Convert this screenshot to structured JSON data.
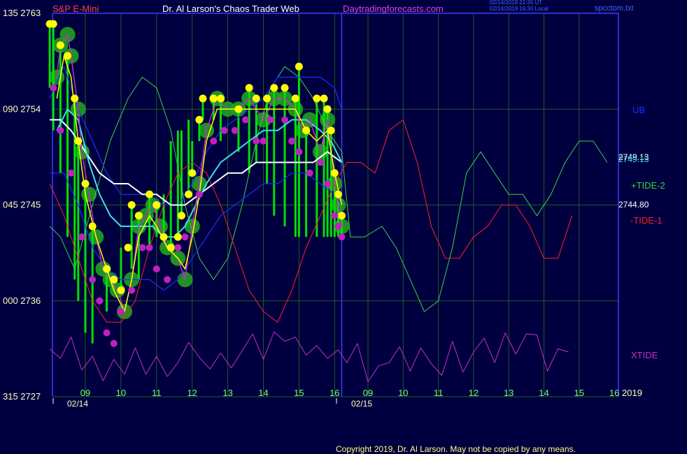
{
  "header": {
    "symbol": "S&P E-Mini",
    "title": "Dr. Al Larson's Chaos Trader Web",
    "site": "Daytradingforecasts.com",
    "stamp_line1": "02/14/2019 21:30 UT",
    "stamp_line2": "02/14/2019 16:30 Local",
    "file": "spcctom.txt"
  },
  "footer": {
    "copyright": "Copyright 2019, Dr. Al Larson. May not be copied by any means."
  },
  "colors": {
    "background": "#000040",
    "grid": "#1f5a1f",
    "axis": "#3a3aff",
    "price_labels": "#ffffc0",
    "time_labels": "#6fff6f",
    "ub": "#1a2fff",
    "lb": "#1a2fff",
    "tide2": "#39d339",
    "tide1": "#ff2020",
    "xtide": "#c030c0",
    "fast_ma": "#ffff00",
    "mid_ma": "#40e0e0",
    "slow_ma": "#ffffff",
    "bars": "#00e000",
    "bubbles": "#22a022",
    "highs": "#ffff00",
    "lows": "#c020c0",
    "title_red": "#ff4040",
    "title_white": "#ffffff",
    "site_magenta": "#e040e0"
  },
  "chart_data": {
    "type": "line",
    "ylim": [
      2727,
      2763
    ],
    "price_ticks": [
      2763,
      2754,
      2745,
      2736,
      2727
    ],
    "left_ticks": [
      "135",
      "090",
      "045",
      "000",
      "315"
    ],
    "hour_labels_day1": [
      "09",
      "10",
      "11",
      "12",
      "13",
      "14",
      "15",
      "16"
    ],
    "hour_labels_day2": [
      "09",
      "10",
      "11",
      "12",
      "13",
      "14",
      "15",
      "16"
    ],
    "date_labels": [
      "02/14",
      "02/15"
    ],
    "year_label": "2019",
    "xlim": [
      7.9,
      40
    ],
    "last_values": [
      "2749.13",
      "2749.13",
      "2744.80"
    ],
    "series_labels": {
      "ub": "UB",
      "tide2": "+TIDE-2",
      "tide1": "-TIDE-1",
      "xtide": "XTIDE"
    },
    "close": [
      [
        8.2,
        2757
      ],
      [
        8.3,
        2760
      ],
      [
        8.5,
        2761
      ],
      [
        8.6,
        2759
      ],
      [
        8.8,
        2754
      ],
      [
        8.9,
        2750
      ],
      [
        9.1,
        2746
      ],
      [
        9.3,
        2742
      ],
      [
        9.5,
        2739
      ],
      [
        9.7,
        2738
      ],
      [
        9.9,
        2737
      ],
      [
        10.1,
        2735
      ],
      [
        10.3,
        2738
      ],
      [
        10.5,
        2743
      ],
      [
        10.7,
        2744
      ],
      [
        10.9,
        2745
      ],
      [
        11.1,
        2743
      ],
      [
        11.3,
        2741
      ],
      [
        11.6,
        2740
      ],
      [
        11.8,
        2738
      ],
      [
        12.0,
        2743
      ],
      [
        12.2,
        2747
      ],
      [
        12.4,
        2752
      ],
      [
        12.7,
        2755
      ],
      [
        13.0,
        2754
      ],
      [
        13.3,
        2754
      ],
      [
        13.6,
        2755
      ],
      [
        14.0,
        2753
      ],
      [
        14.3,
        2755
      ],
      [
        14.6,
        2755
      ],
      [
        14.9,
        2754
      ],
      [
        15.1,
        2752
      ],
      [
        15.3,
        2753
      ],
      [
        15.6,
        2750
      ],
      [
        15.8,
        2753
      ],
      [
        16.0,
        2747
      ],
      [
        16.1,
        2745
      ],
      [
        16.2,
        2743
      ]
    ],
    "highs": [
      [
        8.0,
        2762
      ],
      [
        8.1,
        2762
      ],
      [
        8.3,
        2760
      ],
      [
        8.5,
        2759
      ],
      [
        8.7,
        2755
      ],
      [
        8.8,
        2751
      ],
      [
        9.0,
        2747
      ],
      [
        9.2,
        2743
      ],
      [
        9.6,
        2739
      ],
      [
        9.8,
        2738
      ],
      [
        10.0,
        2737
      ],
      [
        10.2,
        2741
      ],
      [
        10.3,
        2745
      ],
      [
        10.5,
        2744
      ],
      [
        10.8,
        2746
      ],
      [
        11.0,
        2745
      ],
      [
        11.2,
        2742
      ],
      [
        11.4,
        2741
      ],
      [
        11.6,
        2742
      ],
      [
        11.7,
        2744
      ],
      [
        11.9,
        2746
      ],
      [
        12.0,
        2748
      ],
      [
        12.2,
        2753
      ],
      [
        12.3,
        2755
      ],
      [
        12.6,
        2755
      ],
      [
        12.8,
        2755
      ],
      [
        13.3,
        2754
      ],
      [
        13.6,
        2756
      ],
      [
        13.8,
        2755
      ],
      [
        14.1,
        2755
      ],
      [
        14.3,
        2756
      ],
      [
        14.6,
        2756
      ],
      [
        14.9,
        2755
      ],
      [
        15.0,
        2758
      ],
      [
        15.2,
        2752
      ],
      [
        15.5,
        2755
      ],
      [
        15.7,
        2755
      ],
      [
        15.8,
        2754
      ],
      [
        15.9,
        2752
      ],
      [
        16.0,
        2748
      ],
      [
        16.1,
        2746
      ],
      [
        16.2,
        2744
      ]
    ],
    "lows": [
      [
        8.1,
        2756
      ],
      [
        8.3,
        2752
      ],
      [
        8.6,
        2748
      ],
      [
        8.9,
        2742
      ],
      [
        9.2,
        2738
      ],
      [
        9.4,
        2736
      ],
      [
        9.6,
        2733
      ],
      [
        9.8,
        2732
      ],
      [
        10.0,
        2735
      ],
      [
        10.3,
        2737
      ],
      [
        10.6,
        2741
      ],
      [
        10.8,
        2741
      ],
      [
        11.0,
        2739
      ],
      [
        11.3,
        2738
      ],
      [
        11.6,
        2741
      ],
      [
        11.8,
        2742
      ],
      [
        12.2,
        2746
      ],
      [
        12.6,
        2751
      ],
      [
        12.9,
        2752
      ],
      [
        13.2,
        2752
      ],
      [
        13.5,
        2753
      ],
      [
        13.8,
        2751
      ],
      [
        14.0,
        2751
      ],
      [
        14.2,
        2753
      ],
      [
        14.6,
        2753
      ],
      [
        14.8,
        2751
      ],
      [
        15.0,
        2750
      ],
      [
        15.3,
        2748
      ],
      [
        15.6,
        2749
      ],
      [
        15.8,
        2747
      ],
      [
        16.0,
        2744
      ],
      [
        16.1,
        2743
      ],
      [
        16.2,
        2742
      ]
    ],
    "fast_ma": [
      [
        8.2,
        2755
      ],
      [
        8.4,
        2759
      ],
      [
        8.6,
        2757
      ],
      [
        8.8,
        2751
      ],
      [
        9.0,
        2746
      ],
      [
        9.3,
        2742
      ],
      [
        9.6,
        2739
      ],
      [
        9.8,
        2737
      ],
      [
        10.1,
        2735
      ],
      [
        10.3,
        2738
      ],
      [
        10.5,
        2742
      ],
      [
        10.8,
        2744
      ],
      [
        11.0,
        2743
      ],
      [
        11.3,
        2741
      ],
      [
        11.6,
        2740
      ],
      [
        11.8,
        2739
      ],
      [
        12.0,
        2742
      ],
      [
        12.2,
        2746
      ],
      [
        12.4,
        2751
      ],
      [
        12.7,
        2754
      ],
      [
        13.0,
        2754
      ],
      [
        13.4,
        2754
      ],
      [
        13.8,
        2754
      ],
      [
        14.2,
        2754
      ],
      [
        14.6,
        2754
      ],
      [
        14.9,
        2754
      ],
      [
        15.2,
        2752
      ],
      [
        15.5,
        2751
      ],
      [
        15.8,
        2752
      ],
      [
        16.0,
        2748
      ],
      [
        16.2,
        2745
      ]
    ],
    "mid_ma": [
      [
        8.2,
        2752
      ],
      [
        8.5,
        2754
      ],
      [
        8.8,
        2753
      ],
      [
        9.1,
        2749
      ],
      [
        9.4,
        2746
      ],
      [
        9.7,
        2744
      ],
      [
        10.0,
        2743
      ],
      [
        10.3,
        2743
      ],
      [
        10.6,
        2743
      ],
      [
        10.9,
        2743
      ],
      [
        11.2,
        2742
      ],
      [
        11.5,
        2742
      ],
      [
        11.8,
        2743
      ],
      [
        12.1,
        2745
      ],
      [
        12.4,
        2747
      ],
      [
        12.8,
        2749
      ],
      [
        13.2,
        2750
      ],
      [
        13.6,
        2751
      ],
      [
        14.0,
        2752
      ],
      [
        14.4,
        2752
      ],
      [
        14.8,
        2753
      ],
      [
        15.2,
        2753
      ],
      [
        15.6,
        2752
      ],
      [
        15.9,
        2751
      ],
      [
        16.2,
        2749
      ]
    ],
    "slow_ma": [
      [
        8.0,
        2753
      ],
      [
        8.3,
        2753
      ],
      [
        8.6,
        2752
      ],
      [
        9.0,
        2750
      ],
      [
        9.4,
        2748
      ],
      [
        9.8,
        2747
      ],
      [
        10.2,
        2747
      ],
      [
        10.6,
        2746
      ],
      [
        11.0,
        2746
      ],
      [
        11.4,
        2745
      ],
      [
        11.8,
        2745
      ],
      [
        12.2,
        2746
      ],
      [
        12.6,
        2747
      ],
      [
        13.0,
        2748
      ],
      [
        13.4,
        2748
      ],
      [
        13.8,
        2749
      ],
      [
        14.2,
        2749
      ],
      [
        14.6,
        2749
      ],
      [
        15.0,
        2749
      ],
      [
        15.4,
        2749
      ],
      [
        15.8,
        2750
      ],
      [
        16.2,
        2749
      ]
    ],
    "ub": [
      [
        8.0,
        2755
      ],
      [
        8.4,
        2758
      ],
      [
        8.8,
        2754
      ],
      [
        9.2,
        2751
      ],
      [
        9.6,
        2748
      ],
      [
        10.0,
        2746
      ],
      [
        10.4,
        2746
      ],
      [
        10.8,
        2746
      ],
      [
        11.2,
        2745
      ],
      [
        11.6,
        2745
      ],
      [
        12.0,
        2747
      ],
      [
        12.4,
        2750
      ],
      [
        12.8,
        2752
      ],
      [
        13.2,
        2753
      ],
      [
        13.6,
        2754
      ],
      [
        14.0,
        2755
      ],
      [
        14.4,
        2757
      ],
      [
        14.8,
        2757
      ],
      [
        15.2,
        2757
      ],
      [
        15.6,
        2757
      ],
      [
        16.0,
        2756
      ],
      [
        16.2,
        2754
      ]
    ],
    "lb": [
      [
        8.0,
        2748
      ],
      [
        8.4,
        2748
      ],
      [
        8.8,
        2745
      ],
      [
        9.2,
        2741
      ],
      [
        9.6,
        2739
      ],
      [
        10.0,
        2738
      ],
      [
        10.4,
        2738
      ],
      [
        10.8,
        2738
      ],
      [
        11.2,
        2737
      ],
      [
        11.6,
        2738
      ],
      [
        12.0,
        2740
      ],
      [
        12.4,
        2742
      ],
      [
        12.8,
        2744
      ],
      [
        13.2,
        2745
      ],
      [
        13.6,
        2746
      ],
      [
        14.0,
        2747
      ],
      [
        14.4,
        2747
      ],
      [
        14.8,
        2748
      ],
      [
        15.2,
        2748
      ],
      [
        15.6,
        2747
      ],
      [
        16.0,
        2746
      ],
      [
        16.2,
        2745
      ]
    ],
    "tide2": [
      [
        8.0,
        2743
      ],
      [
        8.3,
        2742
      ],
      [
        8.7,
        2739
      ],
      [
        9.2,
        2745
      ],
      [
        9.7,
        2751
      ],
      [
        10.2,
        2755
      ],
      [
        10.6,
        2757
      ],
      [
        11.0,
        2756
      ],
      [
        11.4,
        2752
      ],
      [
        11.8,
        2745
      ],
      [
        12.2,
        2740
      ],
      [
        12.6,
        2738
      ],
      [
        13.0,
        2740
      ],
      [
        13.4,
        2745
      ],
      [
        13.8,
        2751
      ],
      [
        14.2,
        2756
      ],
      [
        14.6,
        2758
      ],
      [
        15.0,
        2757
      ],
      [
        15.4,
        2755
      ],
      [
        15.8,
        2752
      ],
      [
        16.2,
        2750
      ],
      [
        16.5,
        2742
      ],
      [
        16.9,
        2742
      ],
      [
        17.4,
        2743
      ],
      [
        17.8,
        2741
      ],
      [
        18.2,
        2738
      ],
      [
        18.6,
        2735
      ],
      [
        19.0,
        2736
      ],
      [
        19.4,
        2741
      ],
      [
        19.8,
        2748
      ],
      [
        20.2,
        2750
      ],
      [
        20.6,
        2748
      ],
      [
        21.0,
        2746
      ],
      [
        21.4,
        2746
      ],
      [
        21.8,
        2744
      ],
      [
        22.2,
        2746
      ],
      [
        22.6,
        2749
      ],
      [
        23.0,
        2751
      ],
      [
        23.4,
        2751
      ],
      [
        23.8,
        2749
      ]
    ],
    "tide1": [
      [
        8.0,
        2747
      ],
      [
        8.4,
        2744
      ],
      [
        8.8,
        2740
      ],
      [
        9.2,
        2736
      ],
      [
        9.6,
        2734
      ],
      [
        10.0,
        2734
      ],
      [
        10.4,
        2736
      ],
      [
        10.8,
        2741
      ],
      [
        11.2,
        2745
      ],
      [
        11.6,
        2748
      ],
      [
        12.0,
        2749
      ],
      [
        12.4,
        2748
      ],
      [
        12.8,
        2745
      ],
      [
        13.2,
        2741
      ],
      [
        13.6,
        2737
      ],
      [
        14.0,
        2735
      ],
      [
        14.4,
        2734
      ],
      [
        14.8,
        2737
      ],
      [
        15.2,
        2741
      ],
      [
        15.6,
        2744
      ],
      [
        16.0,
        2747
      ],
      [
        16.4,
        2749
      ],
      [
        16.8,
        2749
      ],
      [
        17.2,
        2748
      ],
      [
        17.6,
        2752
      ],
      [
        18.0,
        2753
      ],
      [
        18.4,
        2749
      ],
      [
        18.8,
        2743
      ],
      [
        19.2,
        2740
      ],
      [
        19.6,
        2740
      ],
      [
        20.0,
        2742
      ],
      [
        20.4,
        2743
      ],
      [
        20.8,
        2745
      ],
      [
        21.2,
        2745
      ],
      [
        21.6,
        2743
      ],
      [
        22.0,
        2740
      ],
      [
        22.4,
        2740
      ],
      [
        22.8,
        2744
      ]
    ],
    "xtide": [
      [
        8.0,
        2731.5
      ],
      [
        8.3,
        2730.6
      ],
      [
        8.6,
        2732.6
      ],
      [
        8.9,
        2729.5
      ],
      [
        9.2,
        2730.8
      ],
      [
        9.5,
        2728.5
      ],
      [
        9.8,
        2730.5
      ],
      [
        10.1,
        2729.1
      ],
      [
        10.4,
        2731.6
      ],
      [
        10.7,
        2729.1
      ],
      [
        11.0,
        2730.8
      ],
      [
        11.3,
        2728.9
      ],
      [
        11.6,
        2730.2
      ],
      [
        11.9,
        2732.1
      ],
      [
        12.2,
        2730.7
      ],
      [
        12.5,
        2729.6
      ],
      [
        12.8,
        2731.1
      ],
      [
        13.1,
        2729.7
      ],
      [
        13.4,
        2731.3
      ],
      [
        13.7,
        2732.9
      ],
      [
        14.0,
        2730.5
      ],
      [
        14.3,
        2733.1
      ],
      [
        14.6,
        2732.2
      ],
      [
        14.9,
        2732.6
      ],
      [
        15.2,
        2730.9
      ],
      [
        15.5,
        2731.8
      ],
      [
        15.8,
        2730.6
      ],
      [
        16.1,
        2731.4
      ],
      [
        16.4,
        2730.2
      ],
      [
        16.7,
        2732.0
      ],
      [
        17.0,
        2728.4
      ],
      [
        17.3,
        2729.9
      ],
      [
        17.6,
        2730.2
      ],
      [
        17.9,
        2731.7
      ],
      [
        18.2,
        2729.4
      ],
      [
        18.5,
        2731.6
      ],
      [
        18.8,
        2730.1
      ],
      [
        19.1,
        2729.0
      ],
      [
        19.4,
        2732.2
      ],
      [
        19.7,
        2729.3
      ],
      [
        20.0,
        2731.2
      ],
      [
        20.3,
        2732.5
      ],
      [
        20.6,
        2730.2
      ],
      [
        20.9,
        2733.0
      ],
      [
        21.2,
        2731.0
      ],
      [
        21.5,
        2732.9
      ],
      [
        21.8,
        2732.8
      ],
      [
        22.1,
        2729.4
      ],
      [
        22.4,
        2731.5
      ],
      [
        22.7,
        2731.2
      ]
    ]
  }
}
